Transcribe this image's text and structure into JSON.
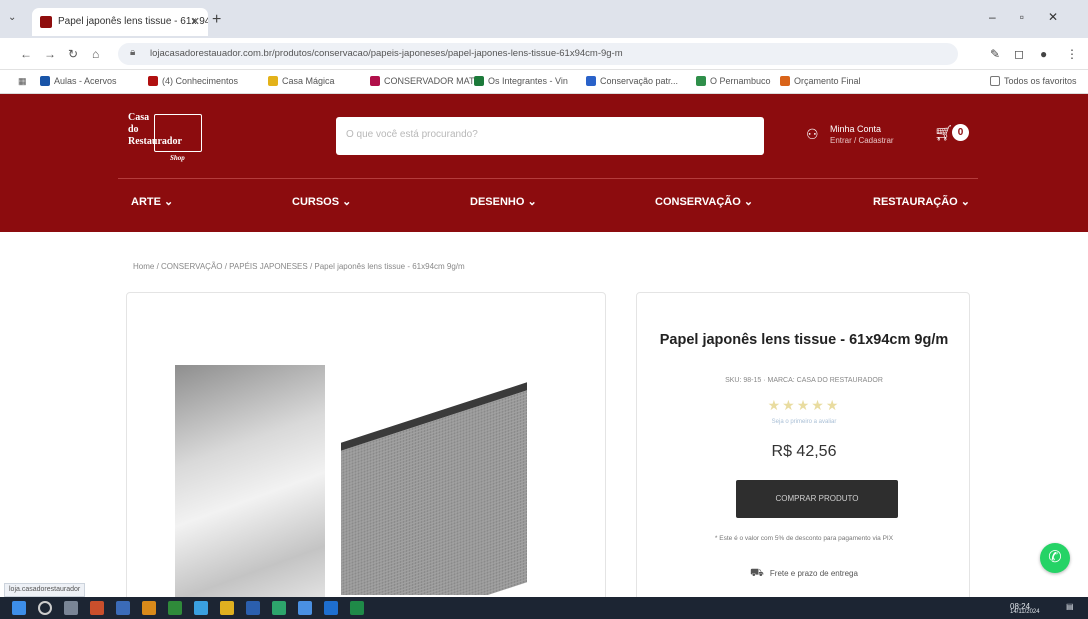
{
  "browser": {
    "tab_title": "Papel japonês lens tissue - 61x 94",
    "url": "lojacasadorestauador.com.br/produtos/conservacao/papeis-japoneses/papel-japones-lens-tissue-61x94cm-9g-m",
    "bookmarks": [
      "Aulas - Acervos",
      "(4) Conhecimentos",
      "Casa Mágica",
      "CONSERVADOR MAT",
      "Os Integrantes - Vin",
      "Conservação patr...",
      "O Pernambuco",
      "Orçamento Final",
      "Todos os favoritos"
    ]
  },
  "site": {
    "logo_lines": [
      "Casa",
      "do",
      "Restaurador"
    ],
    "logo_sub": "Shop",
    "search_placeholder": "O que você está procurando?",
    "account_line1": "Minha Conta",
    "account_line2": "Entrar / Cadastrar",
    "cart_count": "0",
    "menu": [
      "ARTE",
      "CURSOS",
      "DESENHO",
      "CONSERVAÇÃO",
      "RESTAURAÇÃO"
    ]
  },
  "breadcrumb": "Home / CONSERVAÇÃO / PAPÉIS JAPONESES / Papel japonês lens tissue - 61x94cm 9g/m",
  "product": {
    "title": "Papel japonês lens tissue - 61x94cm 9g/m",
    "sku": "SKU: 98-15 · MARCA: CASA DO RESTAURADOR",
    "stars": "★★★★★",
    "reviews": "Seja o primeiro a avaliar",
    "price": "R$ 42,56",
    "button": "COMPRAR PRODUTO",
    "note": "* Este é o valor com 5% de desconto para pagamento via PIX",
    "shipping": "Frete e prazo de entrega"
  },
  "status_url": "loja.casadorestaurador",
  "taskbar_time": "08:24",
  "taskbar_date": "14/11/2024",
  "colors": {
    "brand_red": "#8c0c0e",
    "button_dark": "#2e2e2e",
    "whatsapp": "#25d366"
  }
}
